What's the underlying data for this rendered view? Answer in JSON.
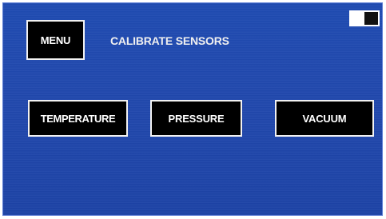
{
  "header": {
    "menu_label": "MENU",
    "title": "CALIBRATE SENSORS"
  },
  "sensors": {
    "temperature_label": "TEMPERATURE",
    "pressure_label": "PRESSURE",
    "vacuum_label": "VACUUM"
  },
  "status": {
    "indicator_icon": "status-toggle-icon"
  },
  "colors": {
    "screen_background": "#1f4bb2",
    "button_background": "#000000",
    "button_border": "#f2f2f2",
    "text": "#ffffff"
  }
}
